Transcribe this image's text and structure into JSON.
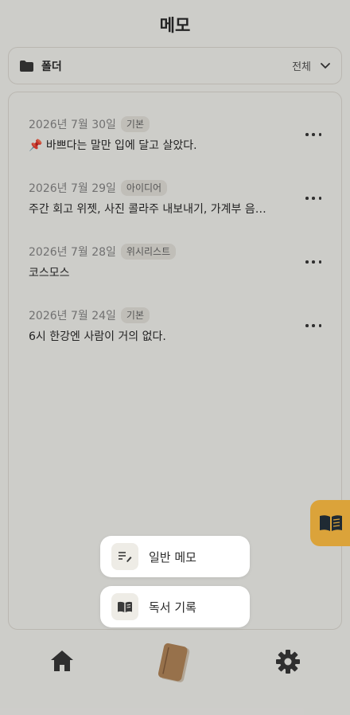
{
  "header": {
    "title": "메모"
  },
  "folder": {
    "label": "폴더",
    "value": "전체",
    "icon": "folder-icon"
  },
  "memos": [
    {
      "date": "2026년 7월 30일",
      "tag": "기본",
      "text": "📌 바쁘다는 말만 입에 달고 살았다."
    },
    {
      "date": "2026년 7월 29일",
      "tag": "아이디어",
      "text": "주간 회고 위젯, 사진 콜라주 내보내기, 가계부 음…"
    },
    {
      "date": "2026년 7월 28일",
      "tag": "위시리스트",
      "text": "코스모스"
    },
    {
      "date": "2026년 7월 24일",
      "tag": "기본",
      "text": "6시 한강엔 사람이 거의 없다."
    }
  ],
  "menu": {
    "general_memo": "일반 메모",
    "reading_record": "독서 기록"
  },
  "nav": {
    "home": "home-icon",
    "book": "notebook-icon",
    "settings": "gear-icon"
  },
  "colors": {
    "accent": "#dba33a",
    "background": "#fbfaf6",
    "book_brown": "#b88a5a"
  }
}
